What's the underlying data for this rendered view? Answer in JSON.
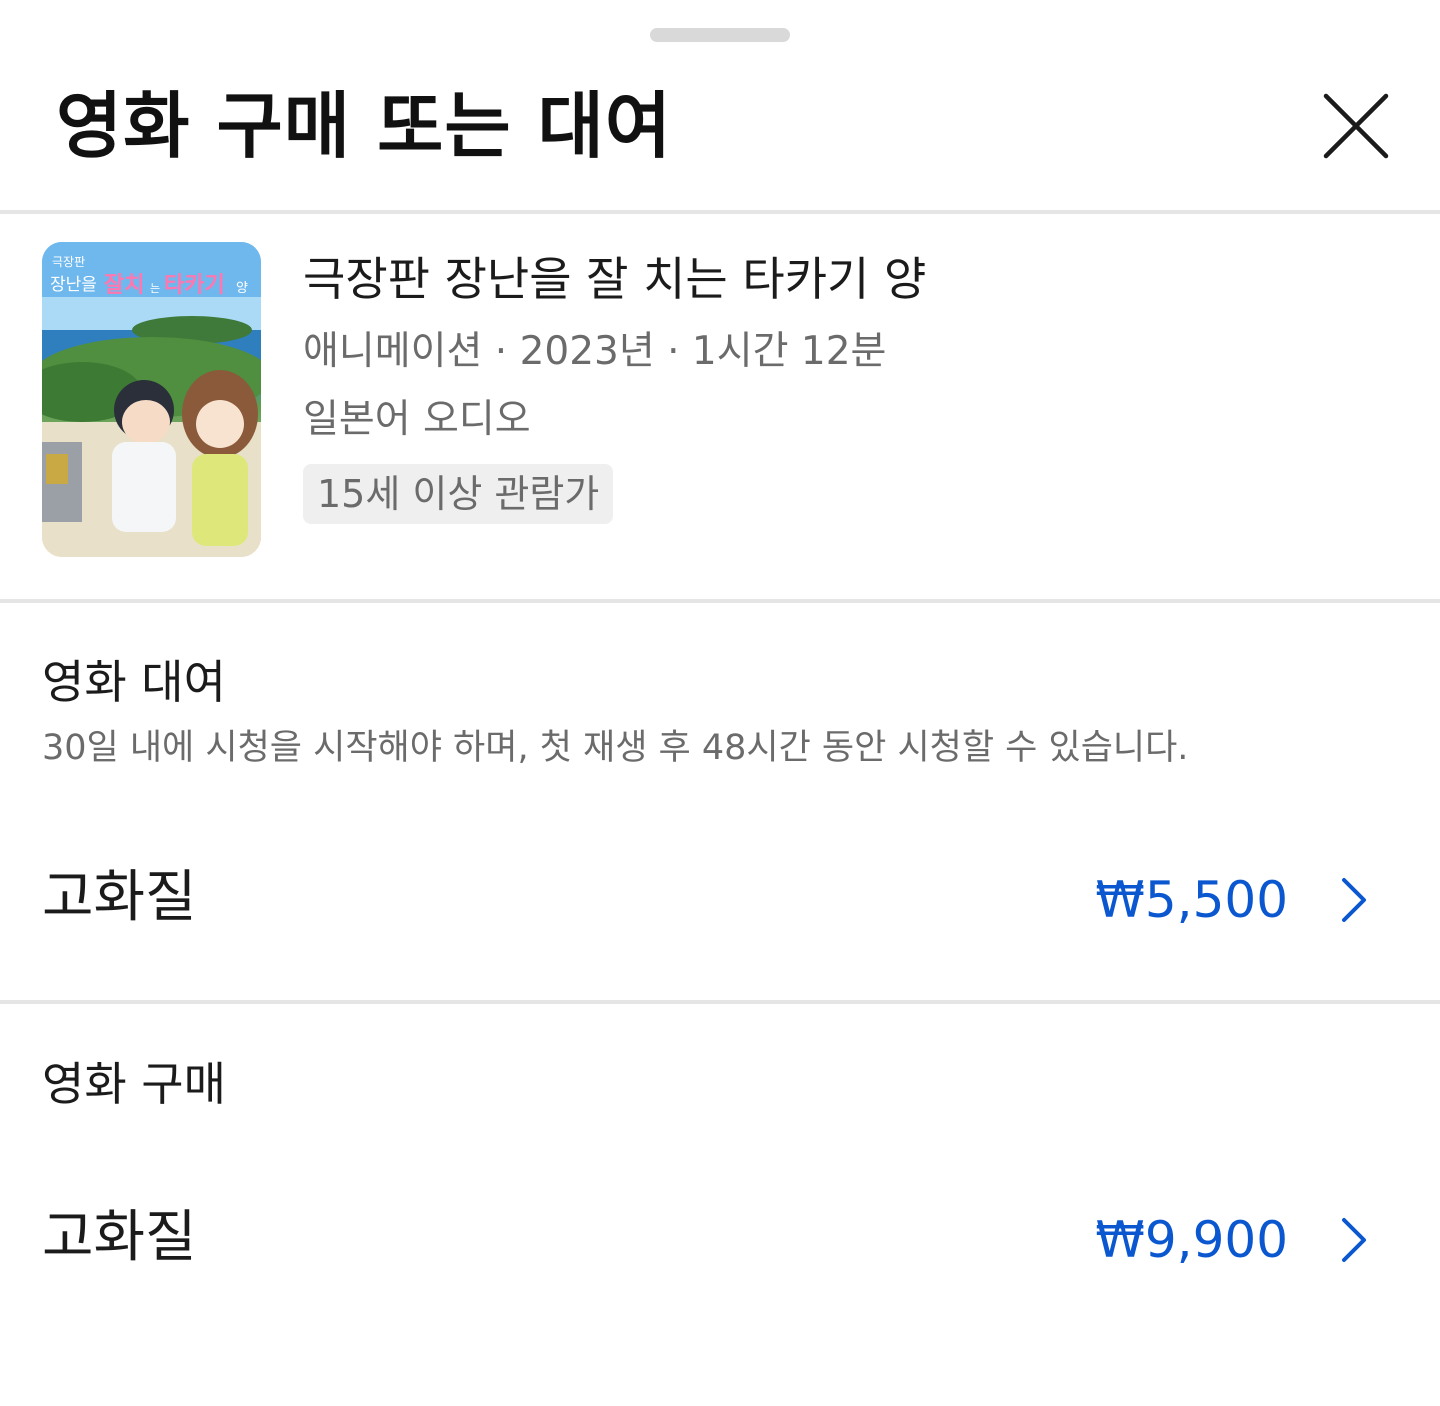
{
  "sheet": {
    "title": "영화 구매 또는 대여",
    "close_icon": "close-icon"
  },
  "movie": {
    "title": "극장판 장난을 잘 치는 타카기 양",
    "meta": "애니메이션 · 2023년 · 1시간 12분",
    "audio": "일본어 오디오",
    "rating": "15세 이상 관람가",
    "poster": {
      "title_line1": "극장판",
      "title_line2_a": "장난을",
      "title_line2_b": "잘치",
      "title_line2_c": "는",
      "title_line2_d": "타카기",
      "title_line2_e": "양"
    }
  },
  "rent": {
    "title": "영화 대여",
    "description": "30일 내에 시청을 시작해야 하며, 첫 재생 후 48시간 동안 시청할 수 있습니다.",
    "options": [
      {
        "label": "고화질",
        "price": "₩5,500"
      }
    ]
  },
  "buy": {
    "title": "영화 구매",
    "options": [
      {
        "label": "고화질",
        "price": "₩9,900"
      }
    ]
  },
  "colors": {
    "accent": "#0b57d0",
    "secondary_text": "#6b6b6b",
    "divider": "#e5e5e5"
  }
}
